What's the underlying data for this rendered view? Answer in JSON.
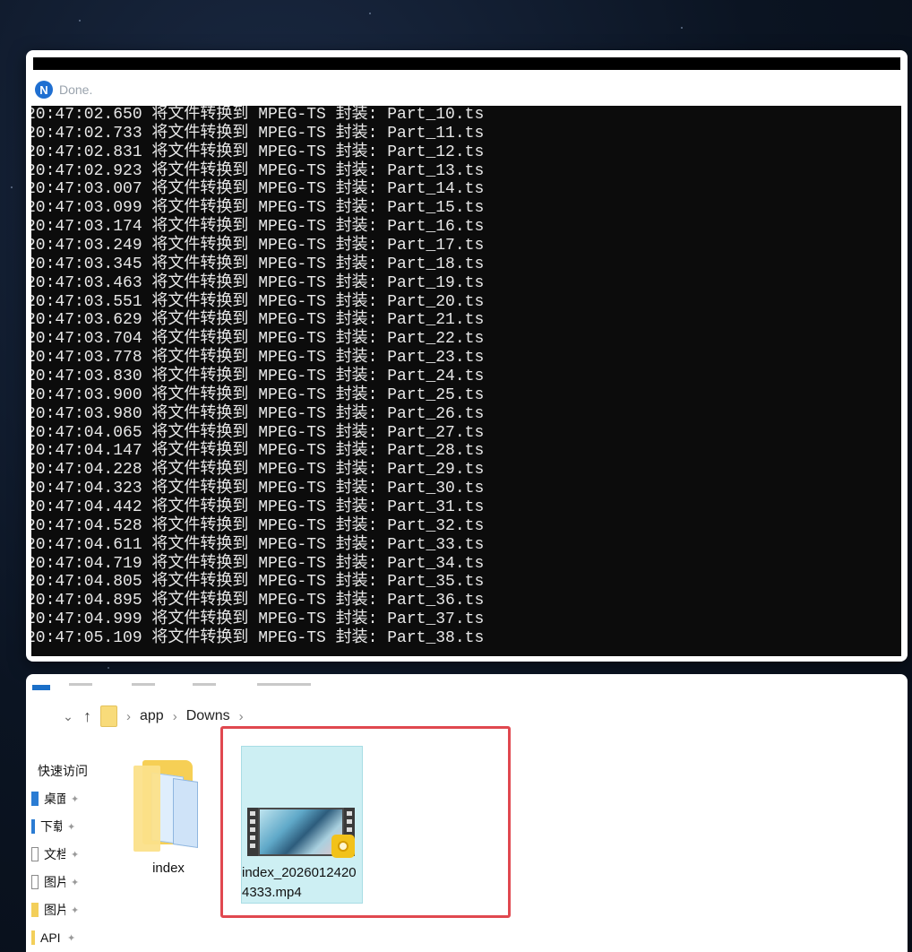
{
  "console": {
    "app_logo": "N",
    "status_text": "Done.",
    "lines": [
      "20:47:02.650 将文件转换到 MPEG-TS 封装: Part_10.ts",
      "20:47:02.733 将文件转换到 MPEG-TS 封装: Part_11.ts",
      "20:47:02.831 将文件转换到 MPEG-TS 封装: Part_12.ts",
      "20:47:02.923 将文件转换到 MPEG-TS 封装: Part_13.ts",
      "20:47:03.007 将文件转换到 MPEG-TS 封装: Part_14.ts",
      "20:47:03.099 将文件转换到 MPEG-TS 封装: Part_15.ts",
      "20:47:03.174 将文件转换到 MPEG-TS 封装: Part_16.ts",
      "20:47:03.249 将文件转换到 MPEG-TS 封装: Part_17.ts",
      "20:47:03.345 将文件转换到 MPEG-TS 封装: Part_18.ts",
      "20:47:03.463 将文件转换到 MPEG-TS 封装: Part_19.ts",
      "20:47:03.551 将文件转换到 MPEG-TS 封装: Part_20.ts",
      "20:47:03.629 将文件转换到 MPEG-TS 封装: Part_21.ts",
      "20:47:03.704 将文件转换到 MPEG-TS 封装: Part_22.ts",
      "20:47:03.778 将文件转换到 MPEG-TS 封装: Part_23.ts",
      "20:47:03.830 将文件转换到 MPEG-TS 封装: Part_24.ts",
      "20:47:03.900 将文件转换到 MPEG-TS 封装: Part_25.ts",
      "20:47:03.980 将文件转换到 MPEG-TS 封装: Part_26.ts",
      "20:47:04.065 将文件转换到 MPEG-TS 封装: Part_27.ts",
      "20:47:04.147 将文件转换到 MPEG-TS 封装: Part_28.ts",
      "20:47:04.228 将文件转换到 MPEG-TS 封装: Part_29.ts",
      "20:47:04.323 将文件转换到 MPEG-TS 封装: Part_30.ts",
      "20:47:04.442 将文件转换到 MPEG-TS 封装: Part_31.ts",
      "20:47:04.528 将文件转换到 MPEG-TS 封装: Part_32.ts",
      "20:47:04.611 将文件转换到 MPEG-TS 封装: Part_33.ts",
      "20:47:04.719 将文件转换到 MPEG-TS 封装: Part_34.ts",
      "20:47:04.805 将文件转换到 MPEG-TS 封装: Part_35.ts",
      "20:47:04.895 将文件转换到 MPEG-TS 封装: Part_36.ts",
      "20:47:04.999 将文件转换到 MPEG-TS 封装: Part_37.ts",
      "20:47:05.109 将文件转换到 MPEG-TS 封装: Part_38.ts"
    ]
  },
  "explorer": {
    "breadcrumb": [
      "app",
      "Downs"
    ],
    "sidebar": {
      "quick_access": "快速访问",
      "items": [
        {
          "label": "桌面",
          "icon": "desktop-icon",
          "color": "#2b7cd3"
        },
        {
          "label": "下载",
          "icon": "download-icon",
          "color": "#2b7cd3"
        },
        {
          "label": "文档",
          "icon": "document-icon",
          "color": "#8a8a8a"
        },
        {
          "label": "图片",
          "icon": "pictures-icon",
          "color": "#8a8a8a"
        },
        {
          "label": "图片",
          "icon": "folder-icon",
          "color": "#f3cf5a"
        },
        {
          "label": "API",
          "icon": "folder-icon",
          "color": "#f3cf5a"
        }
      ]
    },
    "files": [
      {
        "name": "index",
        "type": "folder"
      },
      {
        "name": "index_20260124204333.mp4",
        "type": "video",
        "badge": "Player"
      }
    ]
  },
  "colors": {
    "console_bg": "#0c0c0c",
    "console_text": "#e8e8e8",
    "highlight": "#e0484f",
    "selection": "#cdeff3"
  }
}
